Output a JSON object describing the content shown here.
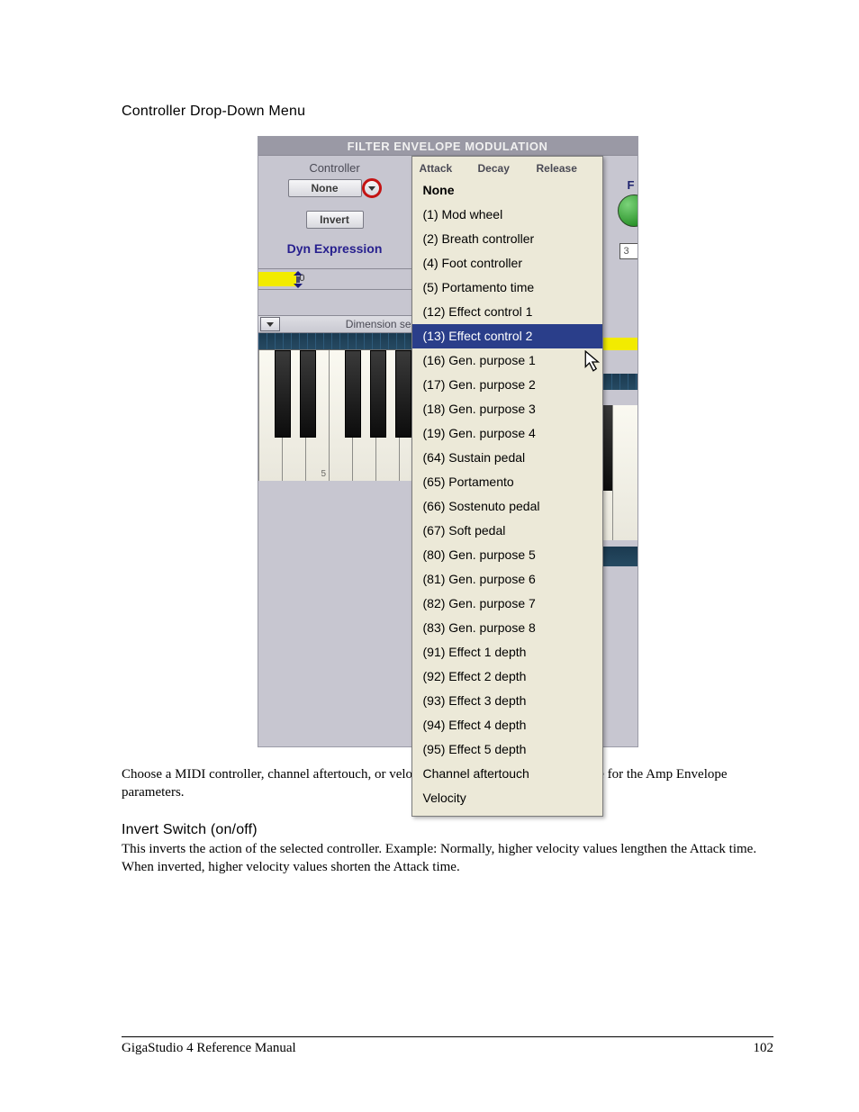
{
  "heading1": "Controller Drop-Down Menu",
  "panel": {
    "title": "FILTER ENVELOPE MODULATION",
    "controller_label": "Controller",
    "none_button": "None",
    "invert_button": "Invert",
    "dyn_expression": "Dyn Expression",
    "slider_value": "0",
    "dimension_label": "Dimension se",
    "octave_label": "5",
    "right_letter": "F",
    "right_box": "3"
  },
  "menu": {
    "h_attack": "Attack",
    "h_decay": "Decay",
    "h_release": "Release",
    "items": [
      "None",
      "(1) Mod wheel",
      "(2) Breath controller",
      "(4) Foot controller",
      "(5) Portamento time",
      "(12) Effect control 1",
      "(13) Effect control 2",
      "(16) Gen. purpose 1",
      "(17) Gen. purpose 2",
      "(18) Gen. purpose 3",
      "(19) Gen. purpose 4",
      "(64) Sustain pedal",
      "(65) Portamento",
      "(66) Sostenuto pedal",
      "(67) Soft pedal",
      "(80) Gen. purpose 5",
      "(81) Gen. purpose 6",
      "(82) Gen. purpose 7",
      "(83) Gen. purpose 8",
      "(91) Effect 1 depth",
      "(92) Effect 2 depth",
      "(93) Effect 3 depth",
      "(94) Effect 4 depth",
      "(95) Effect 5 depth",
      "Channel aftertouch",
      "Velocity"
    ],
    "selected_index": 6
  },
  "para1": "Choose a MIDI controller, channel aftertouch, or velocity to provide a modulation source for the Amp Envelope parameters.",
  "heading2": "Invert Switch (on/off)",
  "para2": "This inverts the action of the selected controller. Example: Normally, higher velocity values lengthen the Attack time. When inverted, higher velocity values shorten the Attack time.",
  "footer_left": "GigaStudio 4 Reference Manual",
  "footer_right": "102"
}
